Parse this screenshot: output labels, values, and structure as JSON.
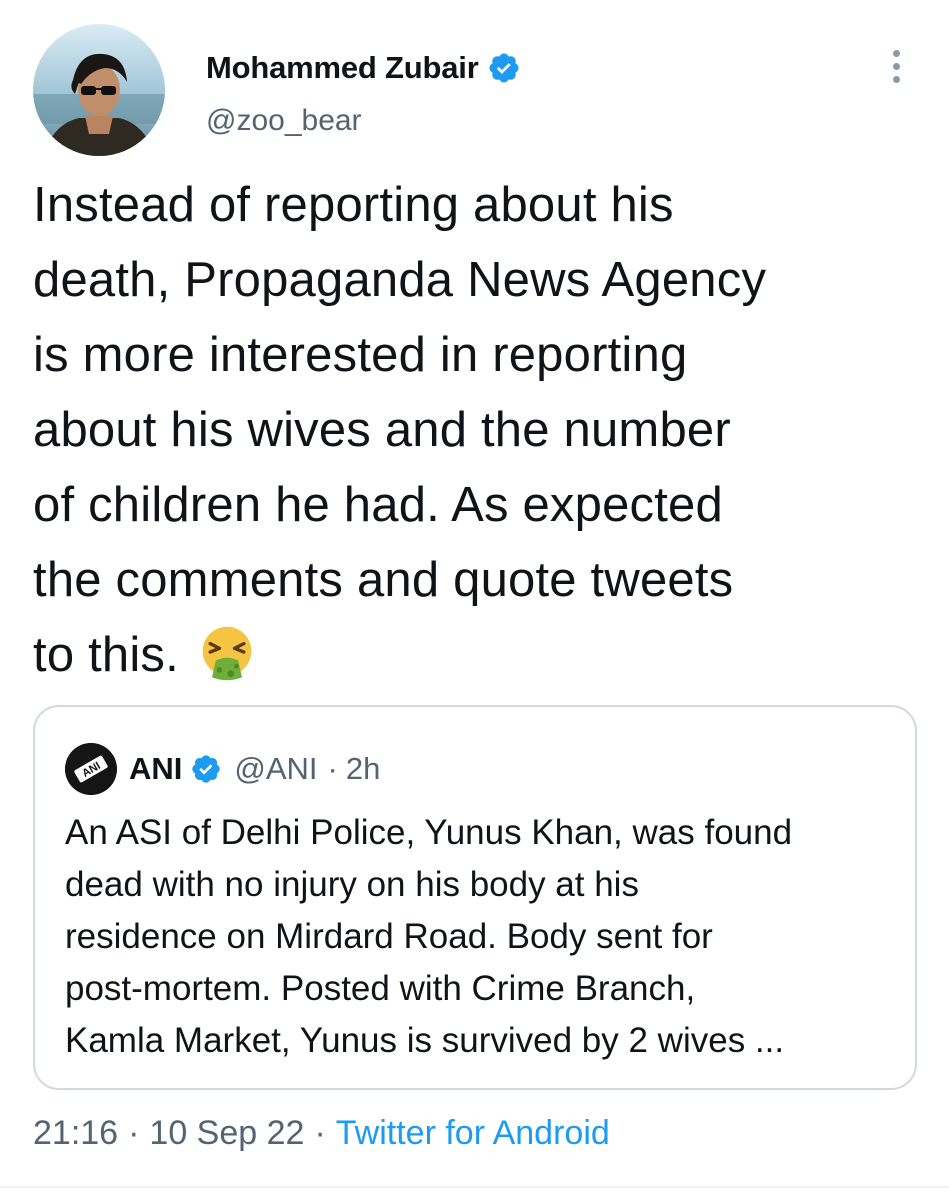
{
  "author": {
    "name": "Mohammed Zubair",
    "handle": "@zoo_bear",
    "verified": true
  },
  "tweet": {
    "text_lines": [
      "Instead of reporting about his",
      "death, Propaganda News Agency",
      "is more interested in reporting",
      "about his wives and the number",
      "of children he had.  As expected",
      "the comments and quote tweets",
      "to this."
    ],
    "emoji": "face-vomiting-emoji"
  },
  "quote": {
    "name": "ANI",
    "handle": "@ANI",
    "separator": "·",
    "time": "2h",
    "avatar_text": "ANI",
    "text_lines": [
      "An ASI of Delhi Police, Yunus Khan, was found",
      "dead with no injury on his body at his",
      "residence on Mirdard Road. Body sent for",
      "post-mortem. Posted with Crime Branch,",
      "Kamla Market, Yunus is survived by 2 wives ..."
    ]
  },
  "footer": {
    "time": "21:16",
    "separator": "·",
    "date": "10 Sep 22",
    "source": "Twitter for Android"
  },
  "colors": {
    "verified": "#1d9bf0",
    "link": "#1d9bf0",
    "secondary_text": "#536471",
    "border": "#cfd9de"
  }
}
